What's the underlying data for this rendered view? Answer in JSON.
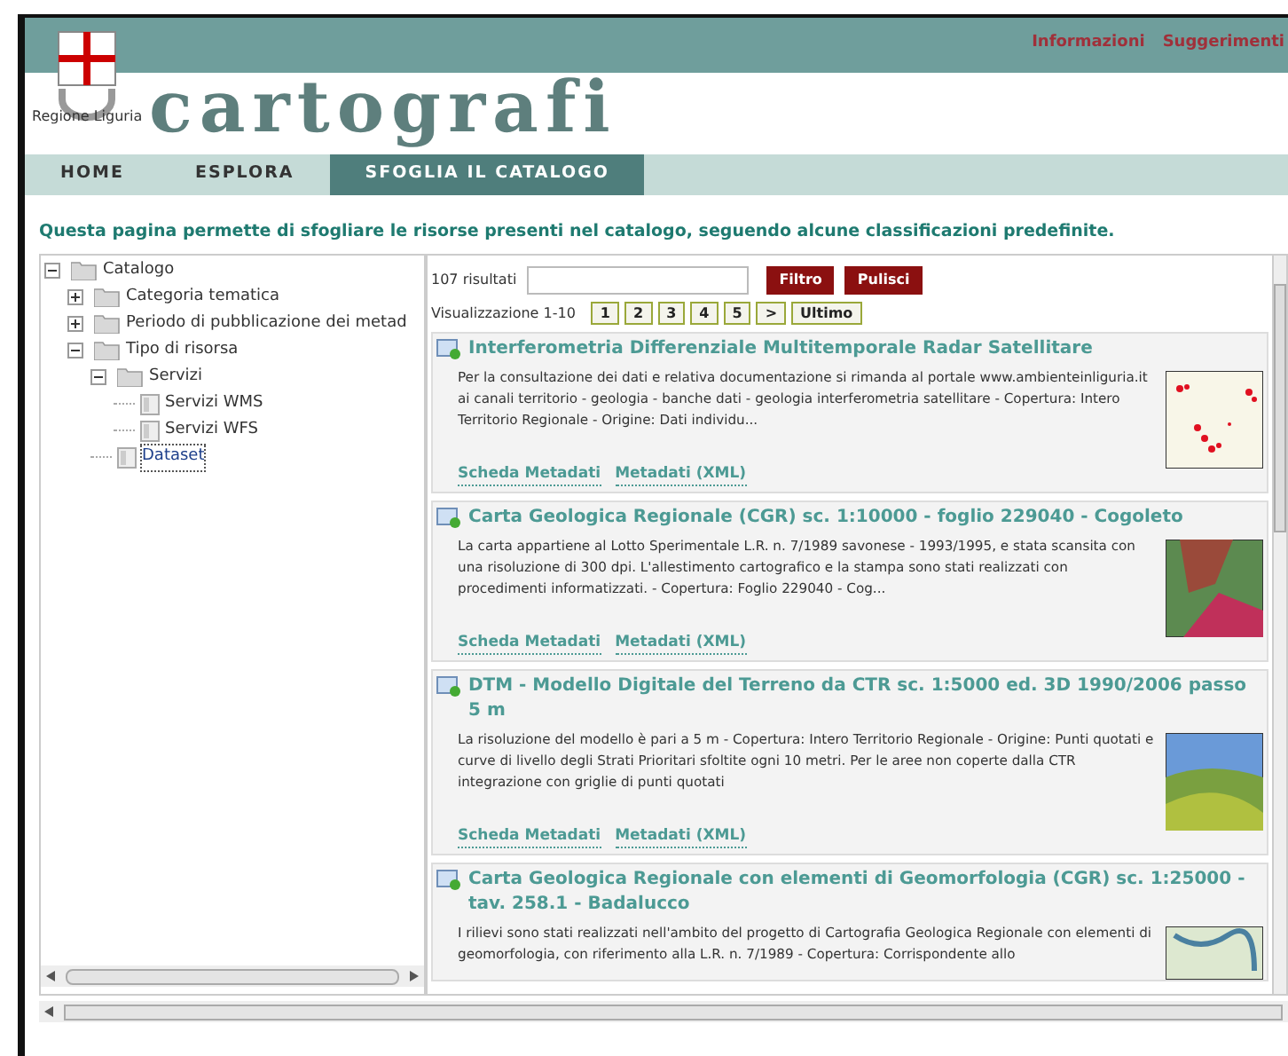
{
  "header": {
    "logo_caption": "Regione Liguria",
    "banner": "cartografi",
    "links": [
      "Informazioni",
      "Suggerimenti"
    ]
  },
  "nav": [
    {
      "label": "HOME",
      "selected": false
    },
    {
      "label": "ESPLORA",
      "selected": false
    },
    {
      "label": "SFOGLIA IL CATALOGO",
      "selected": true
    }
  ],
  "intro": "Questa pagina permette di sfogliare le risorse presenti nel catalogo, seguendo alcune classificazioni predefinite.",
  "tree": [
    {
      "label": "Catalogo",
      "kind": "folder",
      "expanded": true,
      "selected": false,
      "children": [
        {
          "label": "Categoria tematica",
          "kind": "folder",
          "expanded": false,
          "selected": false
        },
        {
          "label": "Periodo di pubblicazione dei metad",
          "kind": "folder",
          "expanded": false,
          "selected": false
        },
        {
          "label": "Tipo di risorsa",
          "kind": "folder",
          "expanded": true,
          "selected": false,
          "children": [
            {
              "label": "Servizi",
              "kind": "folder",
              "expanded": true,
              "selected": false,
              "children": [
                {
                  "label": "Servizi WMS",
                  "kind": "leaf",
                  "selected": false
                },
                {
                  "label": "Servizi WFS",
                  "kind": "leaf",
                  "selected": false
                }
              ]
            },
            {
              "label": "Dataset",
              "kind": "leaf",
              "selected": true
            }
          ]
        }
      ]
    }
  ],
  "results": {
    "count": "107 risultati",
    "filter_button": "Filtro",
    "clear_button": "Pulisci",
    "showing": "Visualizzazione 1-10",
    "pages": [
      "1",
      "2",
      "3",
      "4",
      "5",
      ">",
      "Ultimo"
    ],
    "items": [
      {
        "title": "Interferometria Differenziale Multitemporale Radar Satellitare",
        "description": "Per la consultazione dei dati e relativa documentazione si rimanda al portale www.ambienteinliguria.it ai canali territorio - geologia - banche dati - geologia interferometria satellitare - Copertura: Intero Territorio Regionale - Origine: Dati individu...",
        "kind": "points",
        "links": [
          "Scheda Metadati",
          "Metadati (XML)"
        ]
      },
      {
        "title": "Carta Geologica Regionale (CGR) sc. 1:10000 - foglio 229040 - Cogoleto",
        "description": "La carta appartiene al Lotto Sperimentale L.R. n. 7/1989 savonese - 1993/1995, e stata scansita con una risoluzione di 300 dpi. L'allestimento cartografico e la stampa sono stati realizzati con procedimenti informatizzati. - Copertura: Foglio 229040 - Cog...",
        "kind": "geology",
        "links": [
          "Scheda Metadati",
          "Metadati (XML)"
        ]
      },
      {
        "title": "DTM - Modello Digitale del Terreno da CTR sc. 1:5000 ed. 3D 1990/2006 passo 5 m",
        "description": "La risoluzione del modello è pari a 5 m - Copertura: Intero Territorio Regionale - Origine: Punti quotati e curve di livello degli Strati Prioritari sfoltite ogni 10 metri. Per le aree non coperte dalla CTR integrazione con griglie di punti quotati",
        "kind": "terrain",
        "links": [
          "Scheda Metadati",
          "Metadati (XML)"
        ]
      },
      {
        "title": "Carta Geologica Regionale con elementi di Geomorfologia (CGR) sc. 1:25000 - tav. 258.1 - Badalucco",
        "description": "I rilievi sono stati realizzati nell'ambito del progetto di Cartografia Geologica Regionale con elementi di geomorfologia, con riferimento alla L.R. n. 7/1989 - Copertura: Corrispondente allo",
        "kind": "map"
      }
    ]
  }
}
